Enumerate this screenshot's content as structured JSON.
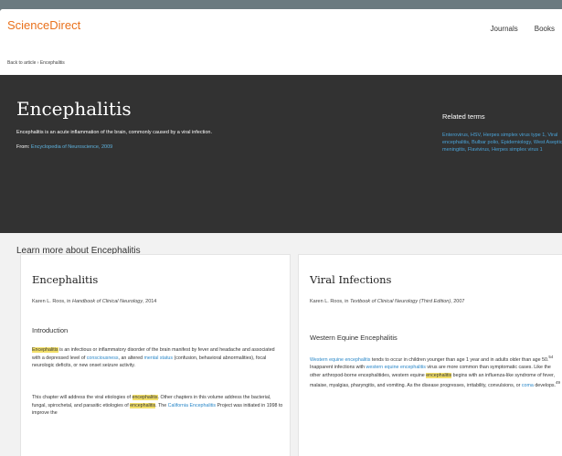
{
  "header": {
    "logo": "ScienceDirect",
    "nav": [
      "Journals",
      "Books"
    ]
  },
  "breadcrumb": "Back to article › Encephalitis",
  "hero": {
    "title": "Encephalitis",
    "definition": "Encephalitis is an acute inflammation of the brain, commonly caused by a viral infection.",
    "from_label": "From:",
    "from_source": "Encyclopedia of Neuroscience, 2009",
    "related_title": "Related terms",
    "related_terms": "Enterovirus, HSV, Herpes simplex virus type 1, Viral encephalitis, Bulbar polio, Epidemiology, West Aseptic meningitis, Flavivirus, Herpes simplex virus 1"
  },
  "learn_more": "Learn more about Encephalitis",
  "cards": [
    {
      "title": "Encephalitis",
      "cite_author": "Karen L. Roos, in",
      "cite_book": "Handbook of Clinical Neurology",
      "cite_year": ", 2014",
      "section": "Introduction",
      "p1_hl": "Encephalitis",
      "p1_a": " is an infectious or inflammatory disorder of the brain manifest by fever and headache and associated with a depressed level of ",
      "p1_l1": "consciousness",
      "p1_b": ", an altered ",
      "p1_l2": "mental status",
      "p1_c": " (confusion, behavioral abnormalities), focal neurologic deficits, or new onset seizure activity.",
      "p2_a": "This chapter will address the viral etiologies of ",
      "p2_hl": "encephalitis",
      "p2_b": ". Other chapters in this volume address the bacterial, fungal, spirochetal, and parasitic etiologies of ",
      "p2_hl2": "encephalitis",
      "p2_c": ". The ",
      "p2_l1": "California Encephalitis",
      "p2_d": " Project was initiated in 1998 to improve the"
    },
    {
      "title": "Viral Infections",
      "cite_author": "Karen L. Roos, in",
      "cite_book": "Textbook of Clinical Neurology (Third Edition)",
      "cite_year": ", 2007",
      "section": "Western Equine Encephalitis",
      "p1_l1": "Western equine encephalitis",
      "p1_a": " tends to occur in children younger than age 1 year and in adults older than age 50.",
      "p1_sup": "54",
      "p1_b": " Inapparent infections with ",
      "p1_l2": "western equine encephalitis",
      "p1_c": " virus are more common than symptomatic cases. Like the other arthropod-borne encephalitides, western equine ",
      "p1_hl": "encephalitis",
      "p1_d": " begins with an influenza-like syndrome of fever, malaise, myalgias, pharyngitis, and vomiting. As the disease progresses, irritability, convulsions, or ",
      "p1_l3": "coma",
      "p1_e": " develops.",
      "p1_sup2": "49"
    }
  ]
}
